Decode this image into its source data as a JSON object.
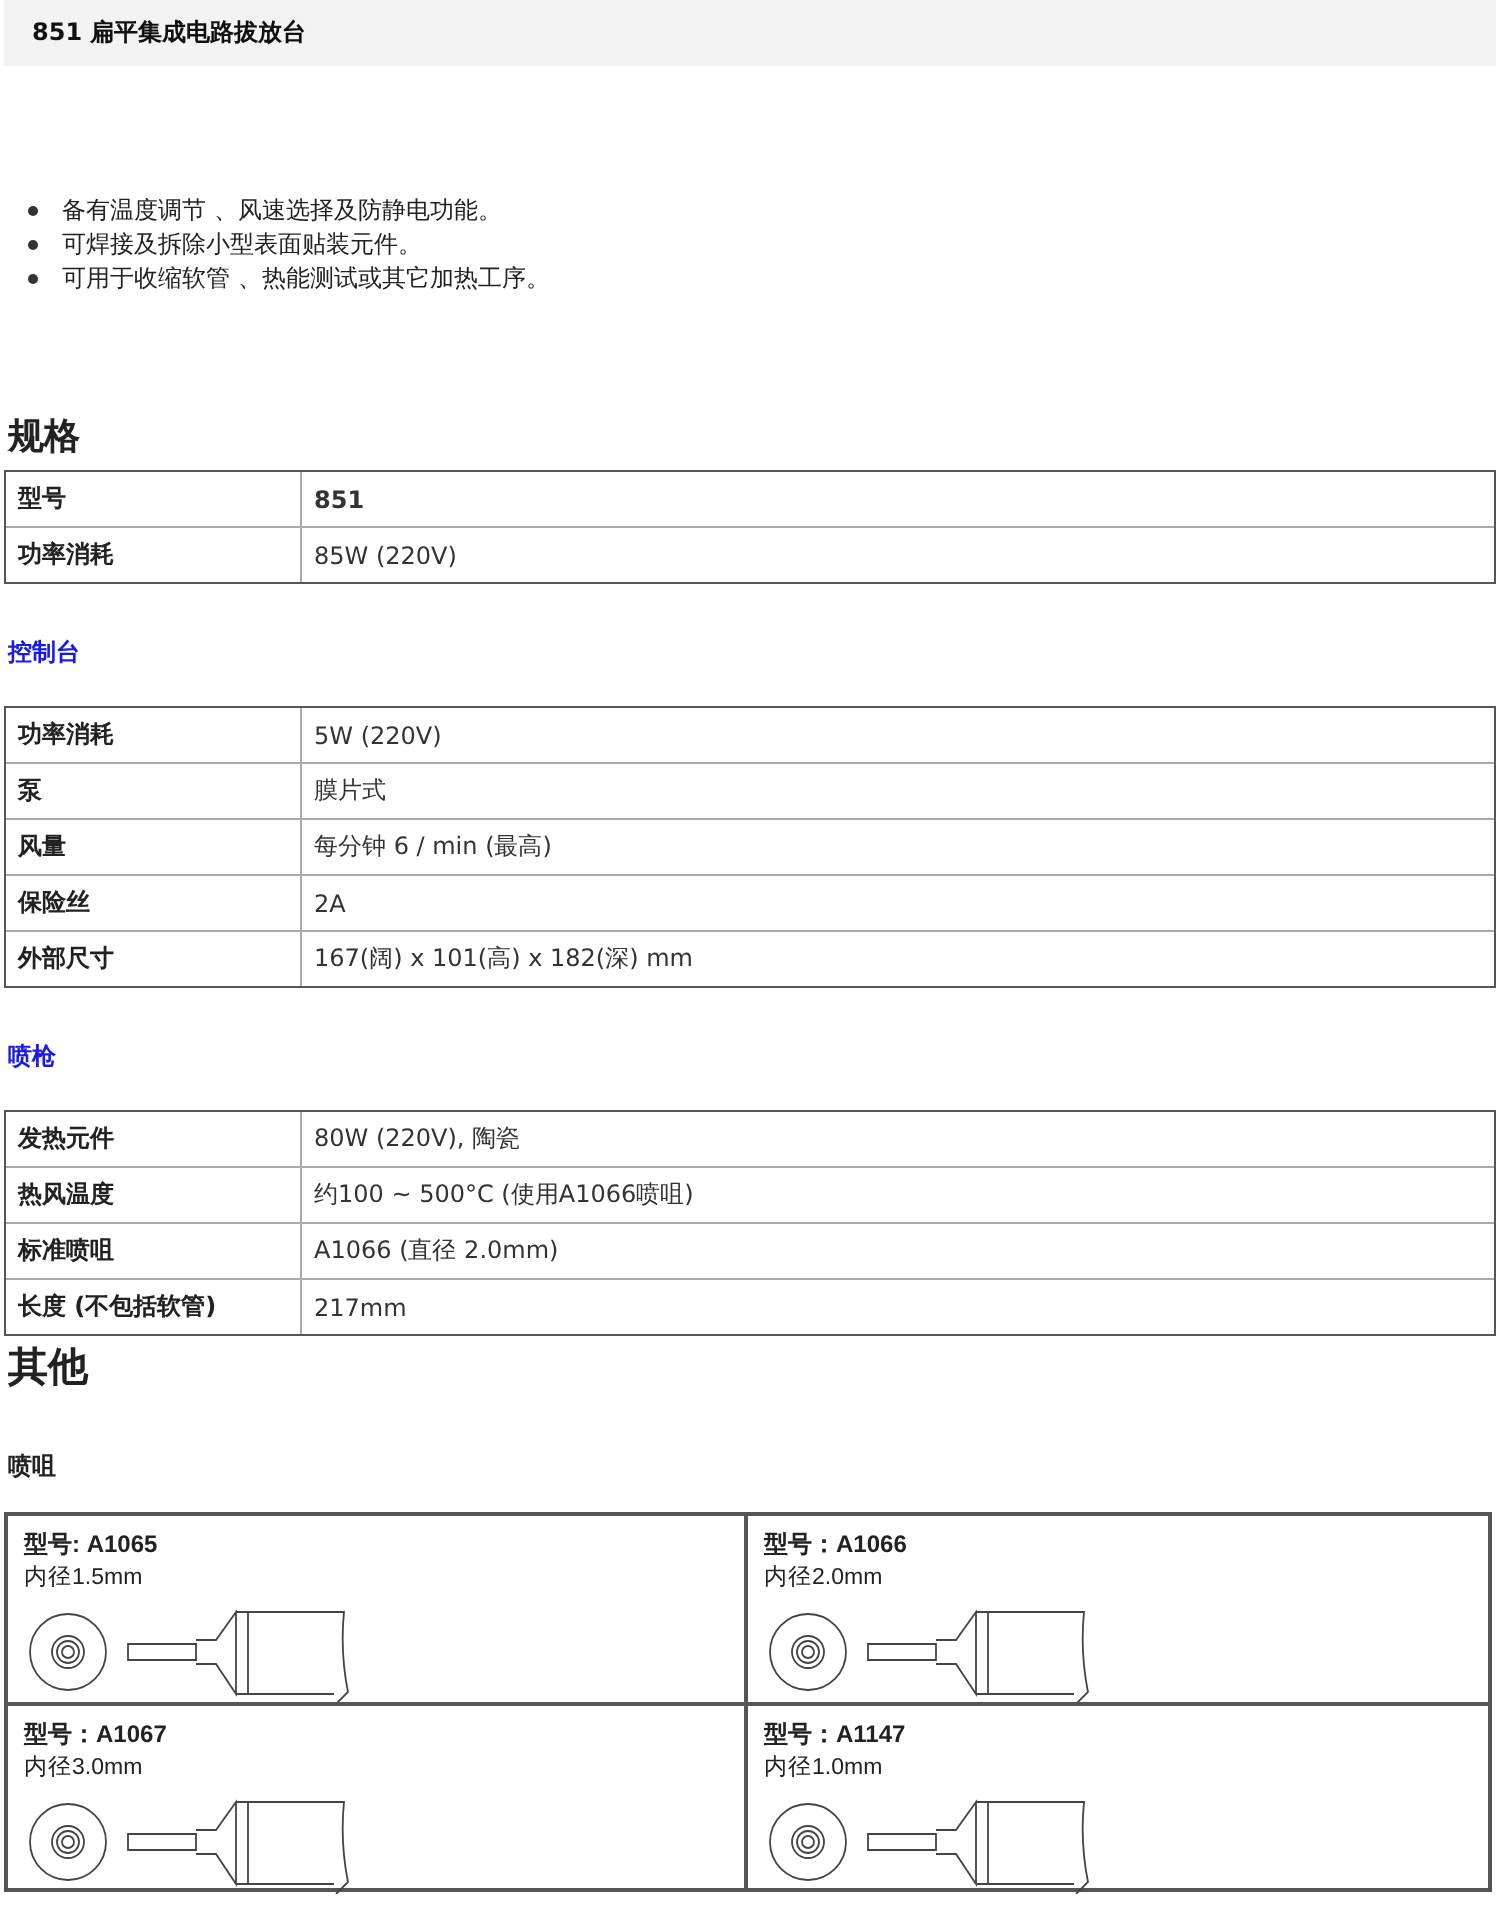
{
  "title": "851 扁平集成电路拔放台",
  "features": [
    "备有温度调节 、风速选择及防静电功能。",
    "可焊接及拆除小型表面贴装元件。",
    "可用于收缩软管 、热能测试或其它加热工序。"
  ],
  "spec_heading": "规格",
  "sections": [
    {
      "rows": [
        {
          "label": "型号",
          "value": "851",
          "bold_value": true
        },
        {
          "label": "功率消耗",
          "value": "85W (220V)",
          "bold_value": false
        }
      ]
    },
    {
      "heading": "控制台",
      "rows": [
        {
          "label": "功率消耗",
          "value": "5W (220V)",
          "bold_value": false
        },
        {
          "label": "泵",
          "value": "膜片式",
          "bold_value": false
        },
        {
          "label": "风量",
          "value": "每分钟 6 / min (最高)",
          "bold_value": false
        },
        {
          "label": "保险丝",
          "value": "2A",
          "bold_value": false
        },
        {
          "label": "外部尺寸",
          "value": "167(阔) x 101(高) x 182(深) mm",
          "bold_value": false
        }
      ]
    },
    {
      "heading": "喷枪",
      "rows": [
        {
          "label": "发热元件",
          "value": "80W (220V), 陶瓷",
          "bold_value": false
        },
        {
          "label": "热风温度",
          "value": "约100 ~ 500°C (使用A1066喷咀)",
          "bold_value": false
        },
        {
          "label": "标准喷咀",
          "value": "A1066 (直径 2.0mm)",
          "bold_value": false
        },
        {
          "label": "长度 (不包括软管)",
          "value": "217mm",
          "bold_value": false
        }
      ]
    }
  ],
  "other_heading": "其他",
  "nozzle_heading": "喷咀",
  "nozzles": [
    {
      "model": "型号: A1065",
      "bore": "内径1.5mm"
    },
    {
      "model": "型号：A1066",
      "bore": "内径2.0mm"
    },
    {
      "model": "型号：A1067",
      "bore": "内径3.0mm"
    },
    {
      "model": "型号：A1147",
      "bore": "内径1.0mm"
    }
  ]
}
